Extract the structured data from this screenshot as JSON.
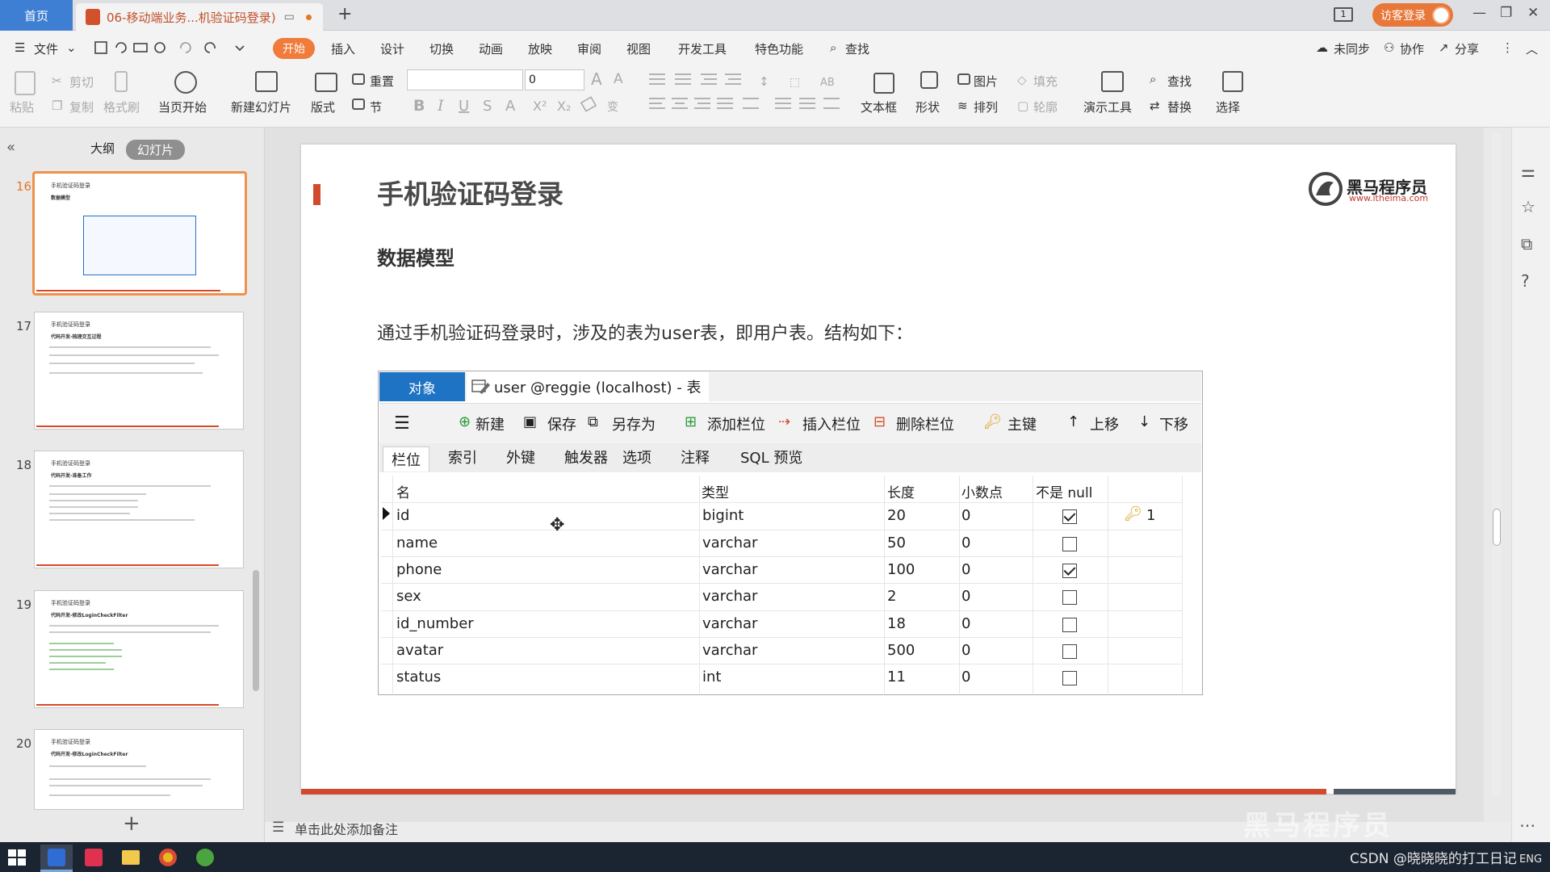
{
  "titlebar": {
    "home_tab": "首页",
    "doc_tab": "06-移动端业务...机验证码登录)",
    "visitor_login": "访客登录"
  },
  "menu": {
    "file": "文件",
    "start": "开始",
    "items": [
      "插入",
      "设计",
      "切换",
      "动画",
      "放映",
      "审阅",
      "视图",
      "开发工具",
      "特色功能"
    ],
    "search": "查找",
    "sync": "未同步",
    "collab": "协作",
    "share": "分享"
  },
  "toolbar": {
    "paste": "粘贴",
    "cut": "剪切",
    "copy": "复制",
    "format_painter": "格式刷",
    "start_from_current": "当页开始",
    "new_slide": "新建幻灯片",
    "layout": "版式",
    "reset": "重置",
    "section": "节",
    "font_size_value": "0",
    "textbox": "文本框",
    "shape": "形状",
    "picture": "图片",
    "fill": "填充",
    "arrange": "排列",
    "outline": "轮廓",
    "present_tools": "演示工具",
    "find": "查找",
    "replace": "替换",
    "select": "选择"
  },
  "left_panel": {
    "outline_tab": "大纲",
    "slides_tab": "幻灯片",
    "thumbnails": [
      {
        "num": "16",
        "title": "手机验证码登录",
        "sub": "数据模型"
      },
      {
        "num": "17",
        "title": "手机验证码登录",
        "sub": "代码开发-梳理交互过程"
      },
      {
        "num": "18",
        "title": "手机验证码登录",
        "sub": "代码开发-准备工作"
      },
      {
        "num": "19",
        "title": "手机验证码登录",
        "sub": "代码开发-修改LoginCheckFilter"
      },
      {
        "num": "20",
        "title": "手机验证码登录",
        "sub": "代码开发-修改LoginCheckFilter"
      }
    ]
  },
  "slide": {
    "title": "手机验证码登录",
    "subtitle": "数据模型",
    "body": "通过手机验证码登录时，涉及的表为user表，即用户表。结构如下：",
    "logo_name": "黑马程序员",
    "logo_url": "www.itheima.com"
  },
  "table_window": {
    "tab_object": "对象",
    "tab_table": "user @reggie (localhost) - 表",
    "tools": [
      "新建",
      "保存",
      "另存为",
      "添加栏位",
      "插入栏位",
      "删除栏位",
      "主键",
      "上移",
      "下移"
    ],
    "subtabs": [
      "栏位",
      "索引",
      "外键",
      "触发器",
      "选项",
      "注释",
      "SQL 预览"
    ],
    "columns": [
      "名",
      "类型",
      "长度",
      "小数点",
      "不是 null"
    ],
    "rows": [
      {
        "name": "id",
        "type": "bigint",
        "length": "20",
        "decimal": "0",
        "not_null": true,
        "key": "1"
      },
      {
        "name": "name",
        "type": "varchar",
        "length": "50",
        "decimal": "0",
        "not_null": false,
        "key": ""
      },
      {
        "name": "phone",
        "type": "varchar",
        "length": "100",
        "decimal": "0",
        "not_null": true,
        "key": ""
      },
      {
        "name": "sex",
        "type": "varchar",
        "length": "2",
        "decimal": "0",
        "not_null": false,
        "key": ""
      },
      {
        "name": "id_number",
        "type": "varchar",
        "length": "18",
        "decimal": "0",
        "not_null": false,
        "key": ""
      },
      {
        "name": "avatar",
        "type": "varchar",
        "length": "500",
        "decimal": "0",
        "not_null": false,
        "key": ""
      },
      {
        "name": "status",
        "type": "int",
        "length": "11",
        "decimal": "0",
        "not_null": false,
        "key": ""
      }
    ]
  },
  "notes": {
    "placeholder": "单击此处添加备注"
  },
  "watermark": "黑马程序员",
  "taskbar": {
    "csdn": "CSDN @晓晓晓的打工日记",
    "lang": "ENG"
  },
  "colors": {
    "accent": "#f07b3b",
    "brand_red": "#d24a2d",
    "navicat_blue": "#1f73c5"
  }
}
